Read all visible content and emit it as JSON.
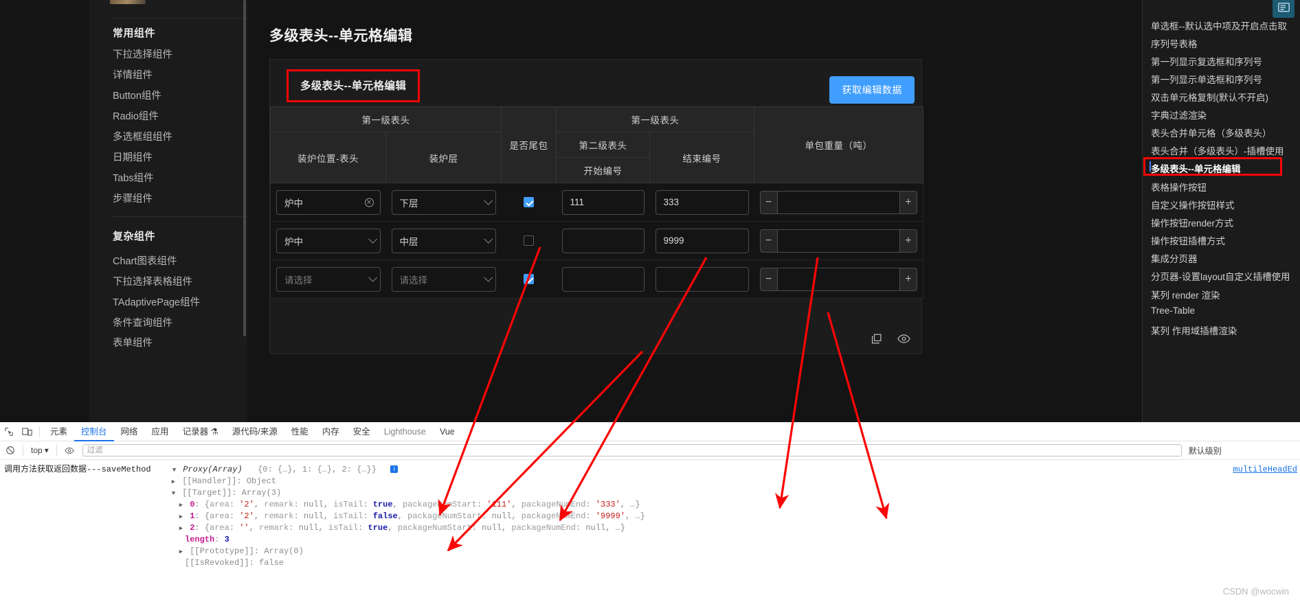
{
  "left_sidebar": {
    "groups": [
      {
        "title": "常用组件",
        "items": [
          "下拉选择组件",
          "详情组件",
          "Button组件",
          "Radio组件",
          "多选框组组件",
          "日期组件",
          "Tabs组件",
          "步骤组件"
        ]
      },
      {
        "title": "复杂组件",
        "items": [
          "Chart图表组件",
          "下拉选择表格组件",
          "TAdaptivePage组件",
          "条件查询组件",
          "表单组件"
        ]
      }
    ]
  },
  "main": {
    "page_title": "多级表头--单元格编辑",
    "card_title": "多级表头--单元格编辑",
    "get_data_button": "获取编辑数据",
    "table": {
      "group_headers": [
        {
          "label": "第一级表头",
          "colspan": 2
        },
        {
          "label": "是否尾包",
          "rowspan": 3
        },
        {
          "label": "第一级表头",
          "colspan": 2
        },
        {
          "label": "单包重量（吨）",
          "rowspan": 3
        }
      ],
      "sub_headers": [
        {
          "label": "第二级表头"
        },
        {
          "label": "结束编号"
        }
      ],
      "leaf_headers": [
        "装炉位置-表头",
        "装炉层",
        "开始编号"
      ],
      "rows": [
        {
          "area": "炉中",
          "area_clearable": true,
          "layer": "下层",
          "is_tail": true,
          "package_num_start": "111",
          "package_num_end": "333",
          "weight": ""
        },
        {
          "area": "炉中",
          "area_clearable": false,
          "layer": "中层",
          "is_tail": false,
          "package_num_start": "",
          "package_num_end": "9999",
          "weight": ""
        },
        {
          "area": "请选择",
          "area_clearable": false,
          "layer": "请选择",
          "is_tail": true,
          "package_num_start": "",
          "package_num_end": "",
          "weight": ""
        }
      ],
      "select_placeholder": "请选择",
      "stepper_minus": "−",
      "stepper_plus": "+"
    },
    "footer_icons": [
      "copy-icon",
      "eye-icon"
    ]
  },
  "right_sidebar": {
    "items": [
      "单选框--默认选中项及开启点击取",
      "序列号表格",
      "第一列显示复选框和序列号",
      "第一列显示单选框和序列号",
      "双击单元格复制(默认不开启)",
      "字典过滤渲染",
      "表头合并单元格（多级表头）",
      "表头合并（多级表头）-插槽使用",
      "多级表头--单元格编辑",
      "表格操作按钮",
      "自定义操作按钮样式",
      "操作按钮render方式",
      "操作按钮插槽方式",
      "集成分页器",
      "分页器-设置layout自定义插槽使用",
      "某列 render 渲染",
      "Tree-Table",
      "某列 作用域插槽渲染"
    ],
    "active_index": 8
  },
  "devtools": {
    "tabs": [
      {
        "label": "元素",
        "active": false,
        "dim": false
      },
      {
        "label": "控制台",
        "active": true,
        "dim": false
      },
      {
        "label": "网络",
        "active": false,
        "dim": false
      },
      {
        "label": "应用",
        "active": false,
        "dim": false
      },
      {
        "label": "记录器 ⚗",
        "active": false,
        "dim": false
      },
      {
        "label": "源代码/来源",
        "active": false,
        "dim": false
      },
      {
        "label": "性能",
        "active": false,
        "dim": false
      },
      {
        "label": "内存",
        "active": false,
        "dim": false
      },
      {
        "label": "安全",
        "active": false,
        "dim": false
      },
      {
        "label": "Lighthouse",
        "active": false,
        "dim": true
      },
      {
        "label": "Vue",
        "active": false,
        "dim": false
      }
    ],
    "context": "top",
    "filter_placeholder": "过滤",
    "level_label": "默认级别",
    "console": {
      "message_prefix": "调用方法获取返回数据---saveMethod",
      "proxy_label": "Proxy(Array)",
      "proxy_preview": "{0: {…}, 1: {…}, 2: {…}}",
      "handler_row": "[[Handler]]: Object",
      "target_row": "[[Target]]: Array(3)",
      "entries": [
        {
          "index": "0",
          "area": "'2'",
          "remark": "null",
          "isTail": "true",
          "packageNumStart": "'111'",
          "packageNumEnd": "'333'"
        },
        {
          "index": "1",
          "area": "'2'",
          "remark": "null",
          "isTail": "false",
          "packageNumStart": "null",
          "packageNumEnd": "'9999'"
        },
        {
          "index": "2",
          "area": "''",
          "remark": "null",
          "isTail": "true",
          "packageNumStart": "null",
          "packageNumEnd": "null"
        }
      ],
      "length_label": "length",
      "length_value": "3",
      "prototype_row": "[[Prototype]]: Array(0)",
      "isrevoked_row": "[[IsRevoked]]: false",
      "source_link": "multileHeadEd"
    }
  },
  "watermark": "CSDN @wocwin",
  "colors": {
    "accent": "#409eff",
    "annotation": "#fb0505",
    "devtools_link": "#1a73e8"
  }
}
